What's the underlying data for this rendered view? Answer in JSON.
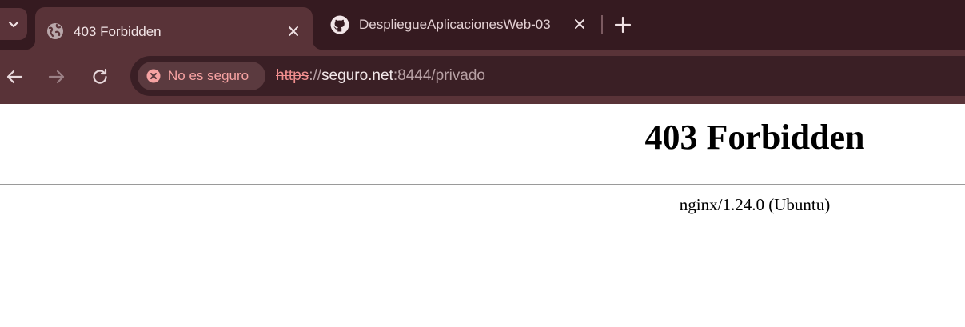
{
  "tabs": [
    {
      "title": "403 Forbidden",
      "icon": "globe-icon",
      "active": true
    },
    {
      "title": "DespliegueAplicacionesWeb-03",
      "icon": "github-icon",
      "active": false
    }
  ],
  "toolbar": {
    "security_label": "No es seguro",
    "url_scheme": "https",
    "url_sep": "://",
    "url_host": "seguro.net",
    "url_rest": ":8444/privado"
  },
  "content": {
    "heading": "403 Forbidden",
    "server_signature": "nginx/1.24.0 (Ubuntu)"
  },
  "colors": {
    "tabstrip_bg": "#351a20",
    "toolbar_bg": "#593338",
    "omnibox_bg": "#3a1f25",
    "warning_red": "#f7a3a3"
  }
}
